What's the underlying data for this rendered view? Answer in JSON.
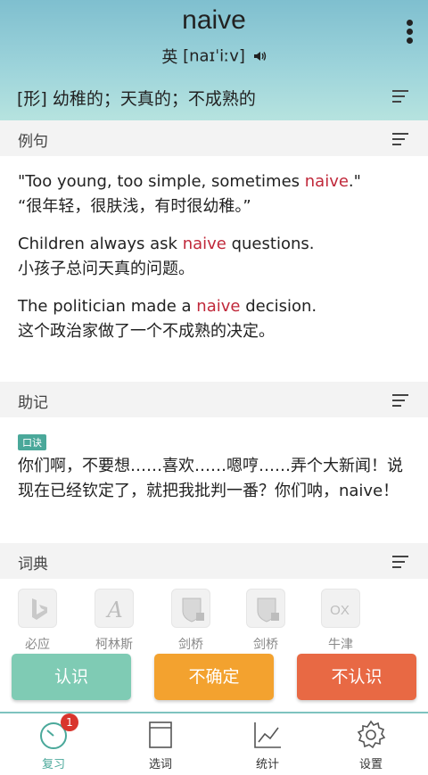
{
  "header": {
    "word": "naive",
    "phonetic_label": "英",
    "phonetic": "[naɪˈiːv]",
    "definition": "[形] 幼稚的；天真的；不成熟的"
  },
  "sections": {
    "examples_label": "例句",
    "mnemonic_label": "助记",
    "dictionary_label": "词典"
  },
  "examples": [
    {
      "en_before": "\"Too young, too simple, sometimes ",
      "en_hl": "naive",
      "en_after": ".\"",
      "zh": "“很年轻，很肤浅，有时很幼稚。”"
    },
    {
      "en_before": "Children always ask ",
      "en_hl": "naive",
      "en_after": " questions.",
      "zh": "小孩子总问天真的问题。"
    },
    {
      "en_before": "The politician made a ",
      "en_hl": "naive",
      "en_after": " decision.",
      "zh": "这个政治家做了一个不成熟的决定。"
    }
  ],
  "mnemonic": {
    "badge": "口诀",
    "text": "你们啊，不要想……喜欢……嗯哼……弄个大新闻！说现在已经钦定了，就把我批判一番？你们呐，naive！"
  },
  "dictionaries": [
    {
      "name": "必应",
      "icon": "bing-icon"
    },
    {
      "name": "柯林斯",
      "icon": "collins-icon"
    },
    {
      "name": "剑桥",
      "icon": "cambridge-icon"
    },
    {
      "name": "剑桥",
      "icon": "cambridge-icon"
    },
    {
      "name": "牛津",
      "icon": "oxford-icon",
      "logo_text": "OX"
    }
  ],
  "actions": {
    "know": "认识",
    "unsure": "不确定",
    "unknown": "不认识"
  },
  "tabbar": {
    "review": "复习",
    "review_badge": "1",
    "select": "选词",
    "stats": "统计",
    "settings": "设置"
  },
  "colors": {
    "highlight": "#c0283a",
    "accent": "#4aa89a",
    "know": "#7fcbb4",
    "unsure": "#f3a22f",
    "unknown": "#e86944"
  }
}
